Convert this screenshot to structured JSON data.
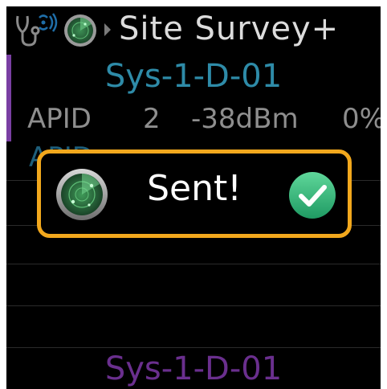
{
  "header": {
    "title": "Site Survey+",
    "icons": [
      "stethoscope-wifi-icon",
      "radar-icon",
      "chevron-right-icon"
    ]
  },
  "list": {
    "selected_item_title": "Sys-1-D-01",
    "row1": {
      "label": "APID",
      "number": "2",
      "signal": "-38dBm",
      "percent": "0%"
    },
    "row2": {
      "text": "APID"
    },
    "bottom_item_title": "Sys-1-D-01"
  },
  "toast": {
    "message": "Sent!",
    "icons": [
      "radar-icon",
      "check-icon"
    ]
  },
  "colors": {
    "accent_border": "#f2a81d",
    "title_blue": "#2e8ba8",
    "purple": "#6a2f8e",
    "check_green": "#2fb67a"
  }
}
